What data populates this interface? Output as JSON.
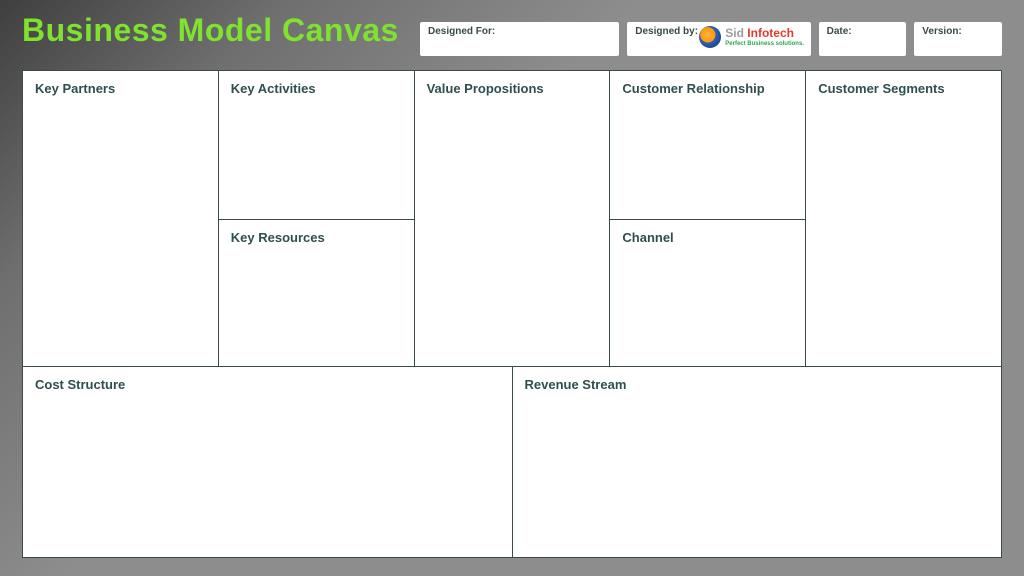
{
  "title": "Business Model Canvas",
  "meta": {
    "designed_for_label": "Designed For:",
    "designed_by_label": "Designed by:",
    "date_label": "Date:",
    "version_label": "Version:",
    "logo": {
      "prefix": "Sid ",
      "accent": "Infotech",
      "tagline": "Perfect Business solutions."
    }
  },
  "sections": {
    "key_partners": "Key Partners",
    "key_activities": "Key Activities",
    "key_resources": "Key Resources",
    "value_propositions": "Value Propositions",
    "customer_relationship": "Customer Relationship",
    "channel": "Channel",
    "customer_segments": "Customer Segments",
    "cost_structure": "Cost Structure",
    "revenue_stream": "Revenue Stream"
  }
}
